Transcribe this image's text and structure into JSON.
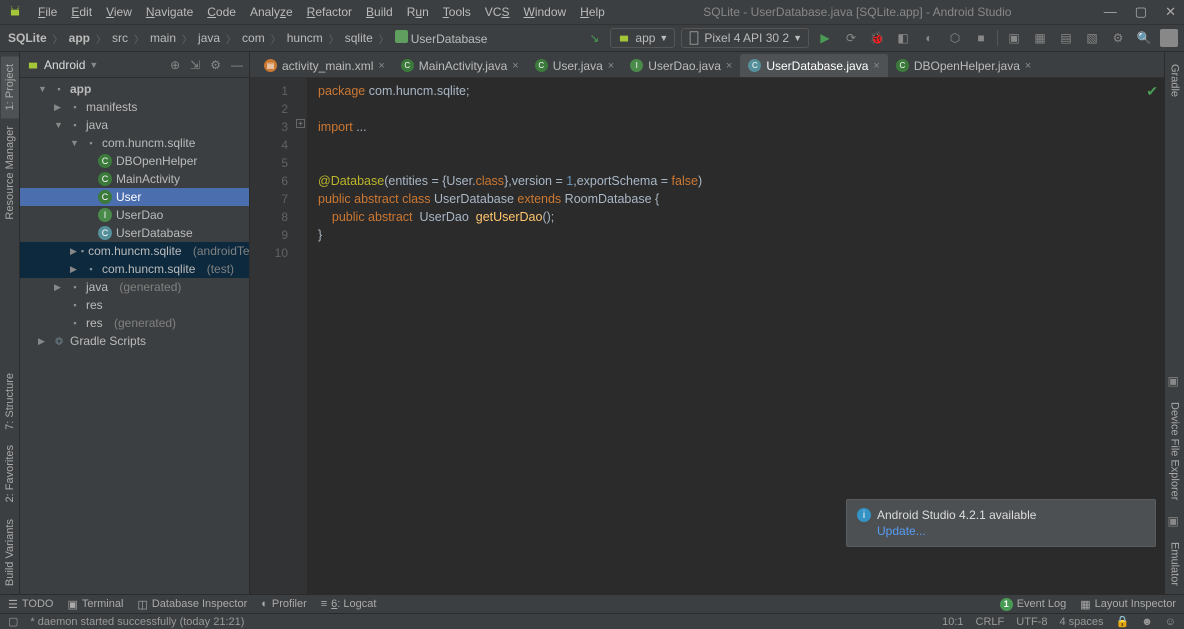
{
  "window": {
    "title": "SQLite - UserDatabase.java [SQLite.app] - Android Studio"
  },
  "menus": [
    "File",
    "Edit",
    "View",
    "Navigate",
    "Code",
    "Analyze",
    "Refactor",
    "Build",
    "Run",
    "Tools",
    "VCS",
    "Window",
    "Help"
  ],
  "breadcrumbs": [
    "SQLite",
    "app",
    "src",
    "main",
    "java",
    "com",
    "huncm",
    "sqlite",
    "UserDatabase"
  ],
  "toolbar": {
    "run_config": "app",
    "device": "Pixel 4 API 30 2"
  },
  "left_rail": [
    "1: Project",
    "Resource Manager",
    "7: Structure",
    "2: Favorites",
    "Build Variants"
  ],
  "right_rail": [
    "Gradle",
    "Device File Explorer",
    "Emulator"
  ],
  "project_pane": {
    "title": "Android",
    "tree": {
      "app": "app",
      "manifests": "manifests",
      "java": "java",
      "pkg": "com.huncm.sqlite",
      "files": [
        "DBOpenHelper",
        "MainActivity",
        "User",
        "UserDao",
        "UserDatabase"
      ],
      "pkg_androidTest": "com.huncm.sqlite",
      "pkg_androidTest_suffix": "(androidTest)",
      "pkg_test": "com.huncm.sqlite",
      "pkg_test_suffix": "(test)",
      "java_gen": "java",
      "java_gen_suffix": "(generated)",
      "res": "res",
      "res_gen": "res",
      "res_gen_suffix": "(generated)",
      "gradle": "Gradle Scripts"
    }
  },
  "tabs": [
    {
      "label": "activity_main.xml",
      "icon": "xml"
    },
    {
      "label": "MainActivity.java",
      "icon": "c"
    },
    {
      "label": "User.java",
      "icon": "c"
    },
    {
      "label": "UserDao.java",
      "icon": "i"
    },
    {
      "label": "UserDatabase.java",
      "icon": "c",
      "active": true
    },
    {
      "label": "DBOpenHelper.java",
      "icon": "c"
    }
  ],
  "editor": {
    "lines": [
      1,
      2,
      3,
      4,
      5,
      6,
      7,
      8,
      9,
      10
    ]
  },
  "code": {
    "l1_kw": "package",
    "l1_pkg": " com.huncm.sqlite;",
    "l3_kw": "import",
    "l3_rest": " ...",
    "l6_anno": "@Database",
    "l6_a": "(entities = {User.",
    "l6_kw_class": "class",
    "l6_b": "},version = ",
    "l6_num": "1",
    "l6_c": ",exportSchema = ",
    "l6_kw_false": "false",
    "l6_d": ")",
    "l7_pub": "public ",
    "l7_abs": "abstract ",
    "l7_cls": "class ",
    "l7_name": "UserDatabase ",
    "l7_ext": "extends ",
    "l7_room": "RoomDatabase {",
    "l8_indent": "    ",
    "l8_pub": "public ",
    "l8_abs": "abstract  ",
    "l8_ret": "UserDao  ",
    "l8_fn": "getUserDao",
    "l8_end": "();",
    "l9": "}"
  },
  "notification": {
    "title": "Android Studio 4.2.1 available",
    "link": "Update..."
  },
  "bottombar": {
    "todo": "TODO",
    "terminal": "Terminal",
    "db": "Database Inspector",
    "profiler": "Profiler",
    "logcat": "6: Logcat",
    "eventlog": "Event Log",
    "layout": "Layout Inspector",
    "notif_count": "1"
  },
  "statusbar": {
    "msg": "* daemon started successfully (today 21:21)",
    "pos": "10:1",
    "le": "CRLF",
    "enc": "UTF-8",
    "indent": "4 spaces"
  }
}
